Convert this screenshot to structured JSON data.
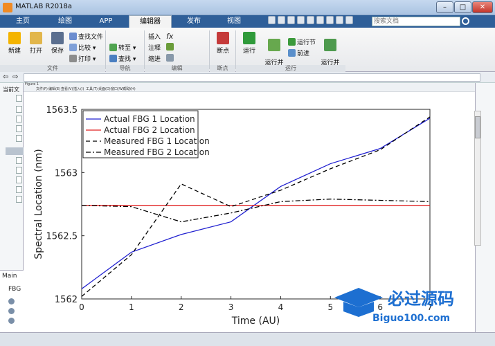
{
  "window": {
    "title": "MATLAB R2018a"
  },
  "tabs": [
    {
      "label": "主页"
    },
    {
      "label": "绘图"
    },
    {
      "label": "APP"
    },
    {
      "label": "编辑器"
    },
    {
      "label": "发布"
    },
    {
      "label": "视图"
    }
  ],
  "search": {
    "placeholder": "搜索文档"
  },
  "ribbon": {
    "new": "新建",
    "open": "打开",
    "save": "保存",
    "find_files": "查找文件",
    "compare": "比较",
    "print": "打印",
    "goto": "转至",
    "find": "查找",
    "insert": "插入",
    "comment": "注释",
    "indent": "缩进",
    "breakpoints": "断点",
    "run": "运行",
    "run_advance": "运行并\n前进",
    "run_section": "运行节",
    "advance": "前进",
    "run_time": "运行并\n计时",
    "groups": {
      "file": "文件",
      "nav": "导航",
      "edit": "编辑",
      "breakpoints": "断点",
      "run": "运行"
    }
  },
  "left_panel": {
    "current_folder": "当前文",
    "section_label": "Main",
    "fbg_label": "FBG"
  },
  "figure": {
    "window_label": "Figure 1",
    "menu": [
      "文件(F)",
      "编辑(E)",
      "查看(V)",
      "插入(I)",
      "工具(T)",
      "桌面(D)",
      "窗口(W)",
      "帮助(H)"
    ]
  },
  "watermark": {
    "brand": "必过源码",
    "url": "Biguo100.com"
  },
  "colors": {
    "actual1": "#2020d0",
    "actual2": "#e02020",
    "measured": "#000000",
    "tabbar": "#2f5f99"
  },
  "chart_data": {
    "type": "line",
    "xlabel": "Time (AU)",
    "ylabel": "Spectral Location (nm)",
    "xlim": [
      0,
      7
    ],
    "ylim": [
      1562,
      1563.5
    ],
    "xticks": [
      0,
      1,
      2,
      3,
      4,
      5,
      6,
      7
    ],
    "yticks": [
      1562,
      1562.5,
      1563,
      1563.5
    ],
    "legend_position": "top-left",
    "x": [
      0,
      1,
      2,
      3,
      4,
      5,
      6,
      7
    ],
    "series": [
      {
        "name": "Actual FBG 1 Location",
        "style": "solid",
        "color": "#2020d0",
        "values": [
          1562.08,
          1562.37,
          1562.51,
          1562.61,
          1562.89,
          1563.07,
          1563.19,
          1563.43
        ]
      },
      {
        "name": "Actual FBG 2 Location",
        "style": "solid",
        "color": "#e02020",
        "values": [
          1562.74,
          1562.74,
          1562.74,
          1562.74,
          1562.74,
          1562.74,
          1562.74,
          1562.74
        ]
      },
      {
        "name": "Measured FBG 1 Location",
        "style": "dashed",
        "color": "#000000",
        "values": [
          1562.02,
          1562.35,
          1562.91,
          1562.73,
          1562.86,
          1563.03,
          1563.18,
          1563.44
        ]
      },
      {
        "name": "Measured FBG 2 Location",
        "style": "dashdot",
        "color": "#000000",
        "values": [
          1562.74,
          1562.73,
          1562.61,
          1562.68,
          1562.77,
          1562.79,
          1562.78,
          1562.77
        ]
      }
    ]
  }
}
